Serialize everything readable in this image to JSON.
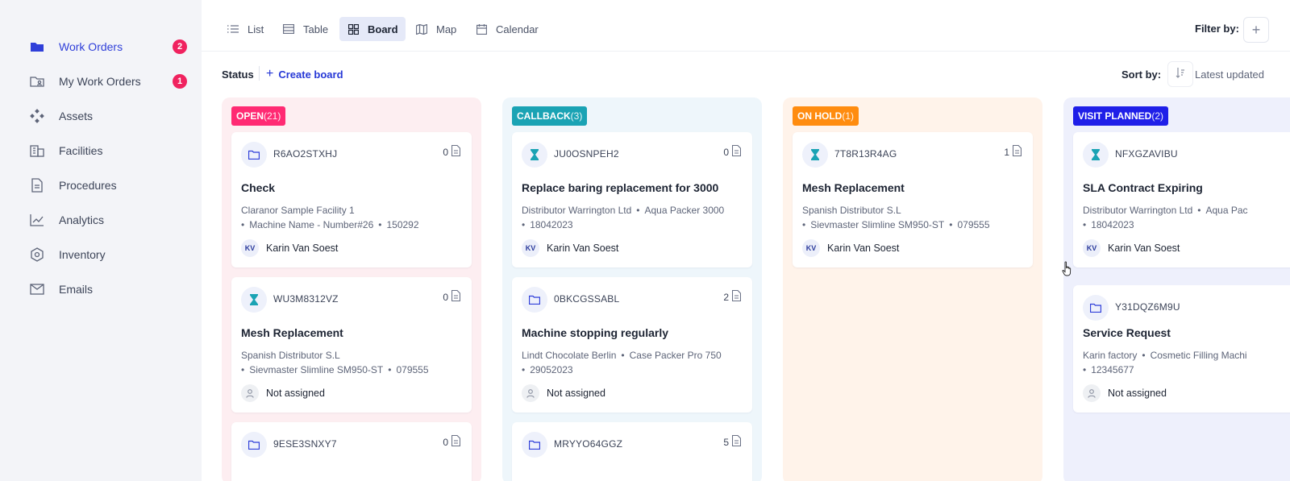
{
  "sidebar": {
    "items": [
      {
        "label": "Work Orders",
        "icon": "folder-icon",
        "active": true,
        "badge": "2"
      },
      {
        "label": "My Work Orders",
        "icon": "user-folder-icon",
        "active": false,
        "badge": "1"
      },
      {
        "label": "Assets",
        "icon": "assets-icon",
        "active": false
      },
      {
        "label": "Facilities",
        "icon": "building-icon",
        "active": false
      },
      {
        "label": "Procedures",
        "icon": "document-icon",
        "active": false
      },
      {
        "label": "Analytics",
        "icon": "chart-icon",
        "active": false
      },
      {
        "label": "Inventory",
        "icon": "box-icon",
        "active": false
      },
      {
        "label": "Emails",
        "icon": "mail-icon",
        "active": false
      }
    ]
  },
  "views": {
    "tabs": [
      {
        "label": "List",
        "icon": "list-icon"
      },
      {
        "label": "Table",
        "icon": "table-icon"
      },
      {
        "label": "Board",
        "icon": "grid-icon",
        "active": true
      },
      {
        "label": "Map",
        "icon": "map-icon"
      },
      {
        "label": "Calendar",
        "icon": "calendar-icon"
      }
    ],
    "filter_label": "Filter by:"
  },
  "toolbar": {
    "status_label": "Status",
    "create_board": "Create board",
    "sort_label": "Sort by:",
    "sort_value": "Latest updated"
  },
  "colors": {
    "accent": "#2f3fd9",
    "badge_red": "#f0225f",
    "open": "#ff2a73",
    "callback": "#1aa3b4",
    "on_hold": "#ff8c0f",
    "visit_planned": "#1f1fe8"
  },
  "columns": [
    {
      "name": "OPEN",
      "count": "(21)",
      "cards": [
        {
          "code": "R6AO2STXHJ",
          "icon": "folder-icon",
          "attachments": "0",
          "title": "Check",
          "meta1": "Claranor Sample Facility 1",
          "meta2a": "Machine Name - Number#26",
          "meta2b": "150292",
          "assignee": "Karin Van Soest",
          "initials": "KV"
        },
        {
          "code": "WU3M8312VZ",
          "icon": "hourglass-icon",
          "attachments": "0",
          "title": "Mesh Replacement",
          "meta1": "Spanish Distributor S.L",
          "meta2a": "Sievmaster Slimline SM950-ST",
          "meta2b": "079555",
          "assignee": "Not assigned",
          "initials": ""
        },
        {
          "code": "9ESE3SNXY7",
          "icon": "folder-icon",
          "attachments": "0"
        }
      ]
    },
    {
      "name": "CALLBACK",
      "count": "(3)",
      "cards": [
        {
          "code": "JU0OSNPEH2",
          "icon": "hourglass-icon",
          "attachments": "0",
          "title": "Replace baring replacement for 3000",
          "meta1a": "Distributor Warrington Ltd",
          "meta1b": "Aqua Packer 3000",
          "meta2": "18042023",
          "assignee": "Karin Van Soest",
          "initials": "KV"
        },
        {
          "code": "0BKCGSSABL",
          "icon": "folder-icon",
          "attachments": "2",
          "title": "Machine stopping regularly",
          "meta1a": "Lindt Chocolate Berlin",
          "meta1b": "Case Packer Pro 750",
          "meta2": "29052023",
          "assignee": "Not assigned",
          "initials": ""
        },
        {
          "code": "MRYYO64GGZ",
          "icon": "folder-icon",
          "attachments": "5"
        }
      ]
    },
    {
      "name": "ON HOLD",
      "count": "(1)",
      "cards": [
        {
          "code": "7T8R13R4AG",
          "icon": "hourglass-icon",
          "attachments": "1",
          "title": "Mesh Replacement",
          "meta1": "Spanish Distributor S.L",
          "meta2a": "Sievmaster Slimline SM950-ST",
          "meta2b": "079555",
          "assignee": "Karin Van Soest",
          "initials": "KV"
        }
      ]
    },
    {
      "name": "VISIT PLANNED",
      "count": "(2)",
      "cards": [
        {
          "code": "NFXGZAVIBU",
          "icon": "hourglass-icon",
          "title": "SLA Contract Expiring",
          "meta1a": "Distributor Warrington Ltd",
          "meta1b": "Aqua Pac",
          "meta2": "18042023",
          "assignee": "Karin Van Soest",
          "initials": "KV"
        },
        {
          "code": "Y31DQZ6M9U",
          "icon": "folder-icon",
          "title": "Service Request",
          "meta1a": "Karin factory",
          "meta1b": "Cosmetic Filling Machi",
          "meta2": "12345677",
          "assignee": "Not assigned",
          "initials": ""
        }
      ]
    }
  ]
}
